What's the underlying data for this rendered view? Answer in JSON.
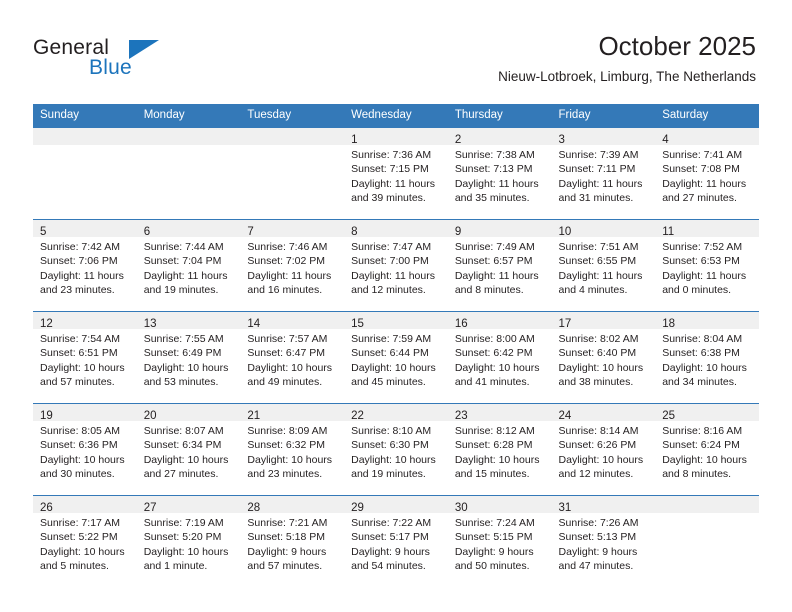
{
  "brand": {
    "name_top": "General",
    "name_bottom": "Blue",
    "accent_color": "#1c74bc",
    "triangle_icon": "triangle-icon"
  },
  "header": {
    "title": "October 2025",
    "subtitle": "Nieuw-Lotbroek, Limburg, The Netherlands"
  },
  "theme": {
    "header_row_bg": "#3479b8",
    "daynum_band_bg": "#f0f0f0",
    "cell_border": "#3479b8",
    "text_color": "#231f20"
  },
  "weekdays": [
    "Sunday",
    "Monday",
    "Tuesday",
    "Wednesday",
    "Thursday",
    "Friday",
    "Saturday"
  ],
  "weeks": [
    [
      {
        "day": "",
        "lines": []
      },
      {
        "day": "",
        "lines": []
      },
      {
        "day": "",
        "lines": []
      },
      {
        "day": "1",
        "lines": [
          "Sunrise: 7:36 AM",
          "Sunset: 7:15 PM",
          "Daylight: 11 hours",
          "and 39 minutes."
        ]
      },
      {
        "day": "2",
        "lines": [
          "Sunrise: 7:38 AM",
          "Sunset: 7:13 PM",
          "Daylight: 11 hours",
          "and 35 minutes."
        ]
      },
      {
        "day": "3",
        "lines": [
          "Sunrise: 7:39 AM",
          "Sunset: 7:11 PM",
          "Daylight: 11 hours",
          "and 31 minutes."
        ]
      },
      {
        "day": "4",
        "lines": [
          "Sunrise: 7:41 AM",
          "Sunset: 7:08 PM",
          "Daylight: 11 hours",
          "and 27 minutes."
        ]
      }
    ],
    [
      {
        "day": "5",
        "lines": [
          "Sunrise: 7:42 AM",
          "Sunset: 7:06 PM",
          "Daylight: 11 hours",
          "and 23 minutes."
        ]
      },
      {
        "day": "6",
        "lines": [
          "Sunrise: 7:44 AM",
          "Sunset: 7:04 PM",
          "Daylight: 11 hours",
          "and 19 minutes."
        ]
      },
      {
        "day": "7",
        "lines": [
          "Sunrise: 7:46 AM",
          "Sunset: 7:02 PM",
          "Daylight: 11 hours",
          "and 16 minutes."
        ]
      },
      {
        "day": "8",
        "lines": [
          "Sunrise: 7:47 AM",
          "Sunset: 7:00 PM",
          "Daylight: 11 hours",
          "and 12 minutes."
        ]
      },
      {
        "day": "9",
        "lines": [
          "Sunrise: 7:49 AM",
          "Sunset: 6:57 PM",
          "Daylight: 11 hours",
          "and 8 minutes."
        ]
      },
      {
        "day": "10",
        "lines": [
          "Sunrise: 7:51 AM",
          "Sunset: 6:55 PM",
          "Daylight: 11 hours",
          "and 4 minutes."
        ]
      },
      {
        "day": "11",
        "lines": [
          "Sunrise: 7:52 AM",
          "Sunset: 6:53 PM",
          "Daylight: 11 hours",
          "and 0 minutes."
        ]
      }
    ],
    [
      {
        "day": "12",
        "lines": [
          "Sunrise: 7:54 AM",
          "Sunset: 6:51 PM",
          "Daylight: 10 hours",
          "and 57 minutes."
        ]
      },
      {
        "day": "13",
        "lines": [
          "Sunrise: 7:55 AM",
          "Sunset: 6:49 PM",
          "Daylight: 10 hours",
          "and 53 minutes."
        ]
      },
      {
        "day": "14",
        "lines": [
          "Sunrise: 7:57 AM",
          "Sunset: 6:47 PM",
          "Daylight: 10 hours",
          "and 49 minutes."
        ]
      },
      {
        "day": "15",
        "lines": [
          "Sunrise: 7:59 AM",
          "Sunset: 6:44 PM",
          "Daylight: 10 hours",
          "and 45 minutes."
        ]
      },
      {
        "day": "16",
        "lines": [
          "Sunrise: 8:00 AM",
          "Sunset: 6:42 PM",
          "Daylight: 10 hours",
          "and 41 minutes."
        ]
      },
      {
        "day": "17",
        "lines": [
          "Sunrise: 8:02 AM",
          "Sunset: 6:40 PM",
          "Daylight: 10 hours",
          "and 38 minutes."
        ]
      },
      {
        "day": "18",
        "lines": [
          "Sunrise: 8:04 AM",
          "Sunset: 6:38 PM",
          "Daylight: 10 hours",
          "and 34 minutes."
        ]
      }
    ],
    [
      {
        "day": "19",
        "lines": [
          "Sunrise: 8:05 AM",
          "Sunset: 6:36 PM",
          "Daylight: 10 hours",
          "and 30 minutes."
        ]
      },
      {
        "day": "20",
        "lines": [
          "Sunrise: 8:07 AM",
          "Sunset: 6:34 PM",
          "Daylight: 10 hours",
          "and 27 minutes."
        ]
      },
      {
        "day": "21",
        "lines": [
          "Sunrise: 8:09 AM",
          "Sunset: 6:32 PM",
          "Daylight: 10 hours",
          "and 23 minutes."
        ]
      },
      {
        "day": "22",
        "lines": [
          "Sunrise: 8:10 AM",
          "Sunset: 6:30 PM",
          "Daylight: 10 hours",
          "and 19 minutes."
        ]
      },
      {
        "day": "23",
        "lines": [
          "Sunrise: 8:12 AM",
          "Sunset: 6:28 PM",
          "Daylight: 10 hours",
          "and 15 minutes."
        ]
      },
      {
        "day": "24",
        "lines": [
          "Sunrise: 8:14 AM",
          "Sunset: 6:26 PM",
          "Daylight: 10 hours",
          "and 12 minutes."
        ]
      },
      {
        "day": "25",
        "lines": [
          "Sunrise: 8:16 AM",
          "Sunset: 6:24 PM",
          "Daylight: 10 hours",
          "and 8 minutes."
        ]
      }
    ],
    [
      {
        "day": "26",
        "lines": [
          "Sunrise: 7:17 AM",
          "Sunset: 5:22 PM",
          "Daylight: 10 hours",
          "and 5 minutes."
        ]
      },
      {
        "day": "27",
        "lines": [
          "Sunrise: 7:19 AM",
          "Sunset: 5:20 PM",
          "Daylight: 10 hours",
          "and 1 minute."
        ]
      },
      {
        "day": "28",
        "lines": [
          "Sunrise: 7:21 AM",
          "Sunset: 5:18 PM",
          "Daylight: 9 hours",
          "and 57 minutes."
        ]
      },
      {
        "day": "29",
        "lines": [
          "Sunrise: 7:22 AM",
          "Sunset: 5:17 PM",
          "Daylight: 9 hours",
          "and 54 minutes."
        ]
      },
      {
        "day": "30",
        "lines": [
          "Sunrise: 7:24 AM",
          "Sunset: 5:15 PM",
          "Daylight: 9 hours",
          "and 50 minutes."
        ]
      },
      {
        "day": "31",
        "lines": [
          "Sunrise: 7:26 AM",
          "Sunset: 5:13 PM",
          "Daylight: 9 hours",
          "and 47 minutes."
        ]
      },
      {
        "day": "",
        "lines": []
      }
    ]
  ]
}
